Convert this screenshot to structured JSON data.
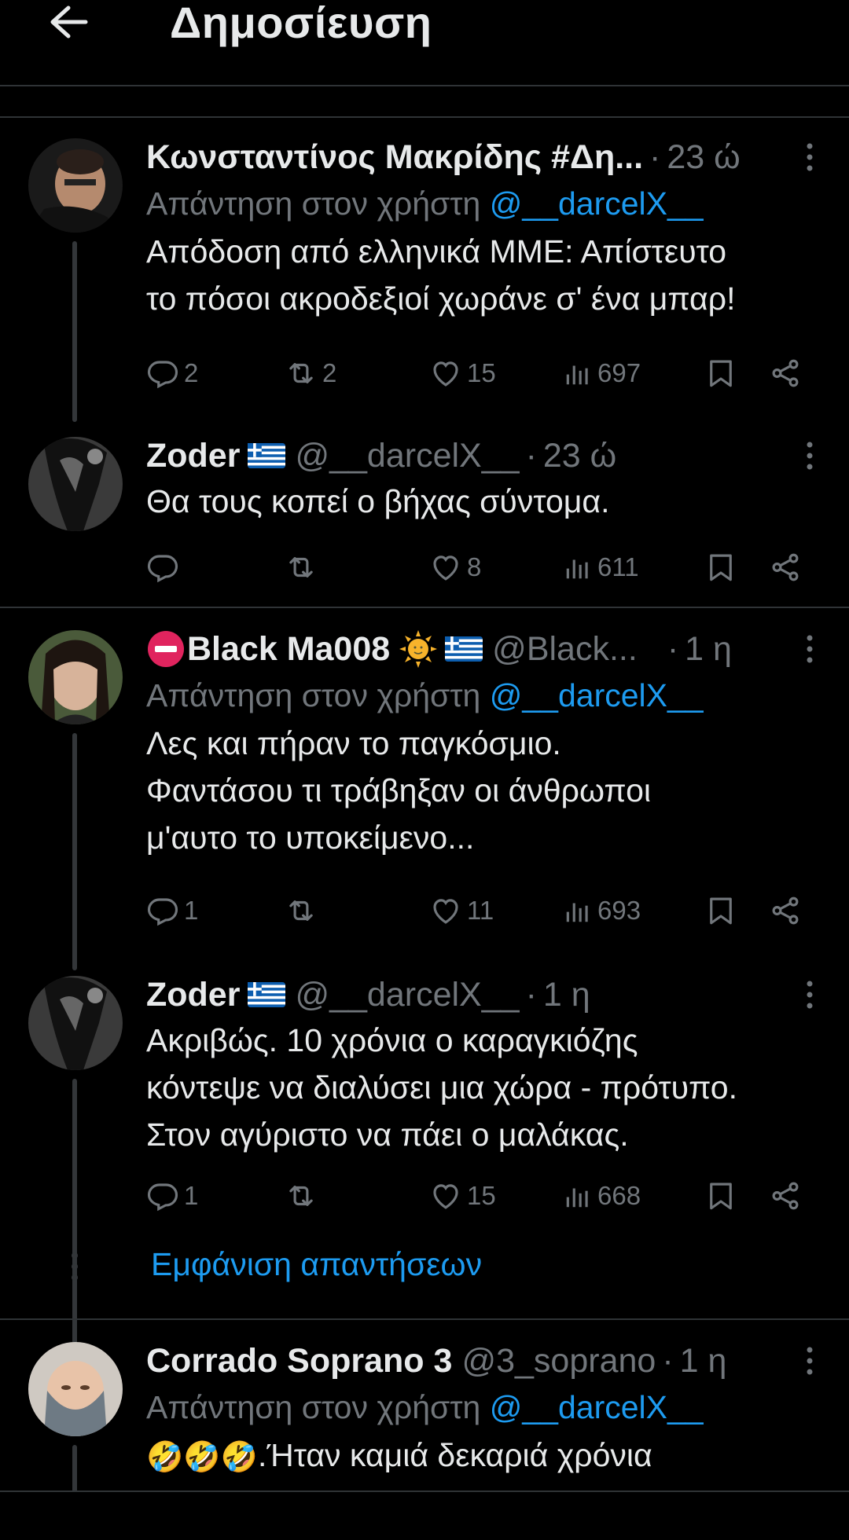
{
  "header": {
    "title": "Δημοσίευση"
  },
  "posts": [
    {
      "name": "Κωνσταντίνος Μακρίδης #Δη...",
      "handle": "",
      "dot": "·",
      "time": "23 ώ",
      "reply_prefix": "Απάντηση στον χρήστη",
      "reply_handle": "@__darcelX__",
      "text": "Απόδοση από ελληνικά ΜΜΕ: Απίστευτο\nτο πόσοι ακροδεξιοί χωράνε σ' ένα μπαρ!",
      "replies": "2",
      "reposts": "2",
      "likes": "15",
      "views": "697"
    },
    {
      "name": "Zoder",
      "handle": "@__darcelX__",
      "dot": "·",
      "time": "23 ώ",
      "text": "Θα τους κοπεί ο βήχας σύντομα.",
      "replies": "",
      "reposts": "",
      "likes": "8",
      "views": "611"
    },
    {
      "name": "Black Ma008",
      "handle": "@Black...",
      "dot": "·",
      "time": "1 η",
      "reply_prefix": "Απάντηση στον χρήστη",
      "reply_handle": "@__darcelX__",
      "text": "Λες και πήραν το παγκόσμιο.\nΦαντάσου τι τράβηξαν οι άνθρωποι\nμ'αυτο το υποκείμενο...",
      "replies": "1",
      "reposts": "",
      "likes": "11",
      "views": "693"
    },
    {
      "name": "Zoder",
      "handle": "@__darcelX__",
      "dot": "·",
      "time": "1 η",
      "text": "Ακριβώς. 10 χρόνια ο καραγκιόζης\nκόντεψε να διαλύσει μια χώρα - πρότυπο.\nΣτον αγύριστο να πάει ο μαλάκας.",
      "replies": "1",
      "reposts": "",
      "likes": "15",
      "views": "668"
    },
    {
      "name": "Corrado Soprano 3",
      "handle": "@3_soprano",
      "dot": "·",
      "time": "1 η",
      "reply_prefix": "Απάντηση στον χρήστη",
      "reply_handle": "@__darcelX__",
      "text_emoji": "🤣🤣🤣",
      "text": ".Ήταν καμιά δεκαριά χρόνια"
    }
  ],
  "show_replies": "Εμφάνιση απαντήσεων",
  "colors": {
    "background": "#000000",
    "accent": "#1d9bf0",
    "muted": "#71767b",
    "divider": "#2f3336"
  },
  "icons": [
    "back-arrow-icon",
    "more-vertical-icon",
    "reply-icon",
    "repost-icon",
    "like-icon",
    "views-icon",
    "bookmark-icon",
    "share-icon",
    "no-entry-icon",
    "sun-icon",
    "greece-flag-icon"
  ]
}
